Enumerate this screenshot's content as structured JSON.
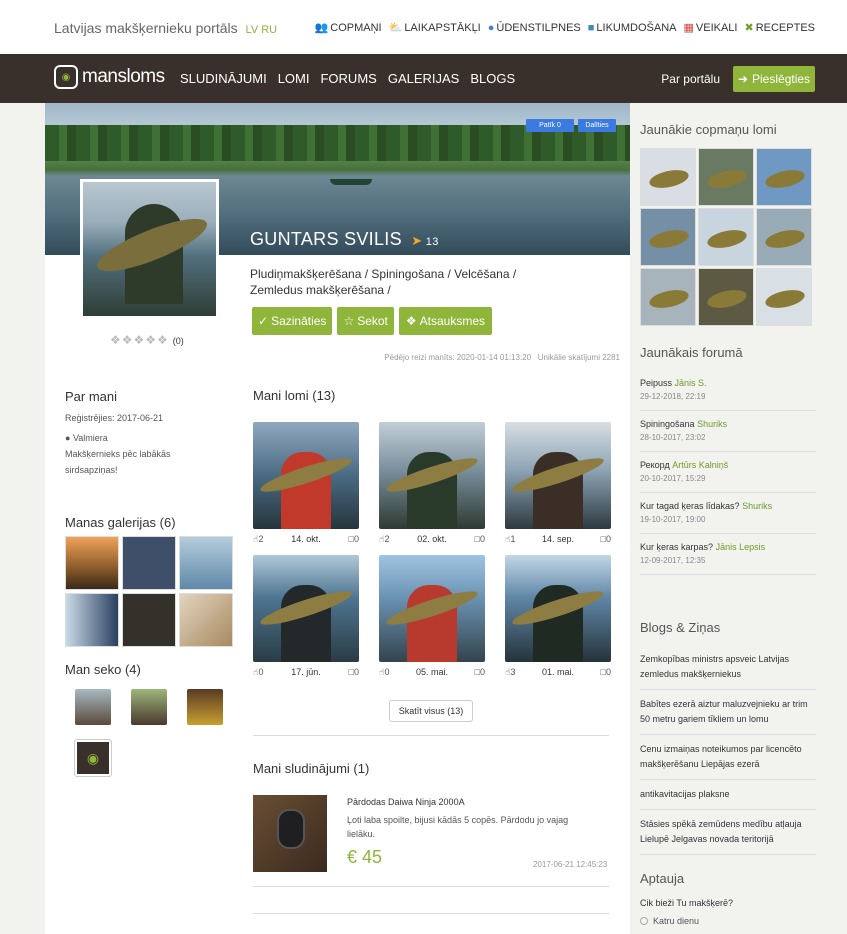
{
  "topbar": {
    "title": "Latvijas makšķernieku portāls",
    "lang": "LV RU",
    "links": [
      {
        "label": "COPMAŅI",
        "icon": "people-icon"
      },
      {
        "label": "LAIKAPSTĀKĻI",
        "icon": "weather-icon"
      },
      {
        "label": "ŪDENSTILPNES",
        "icon": "location-pin-icon"
      },
      {
        "label": "LIKUMDOŠANA",
        "icon": "book-icon"
      },
      {
        "label": "VEIKALI",
        "icon": "cart-icon"
      },
      {
        "label": "RECEPTES",
        "icon": "utensils-icon"
      }
    ]
  },
  "nav": {
    "logo_a": "mans",
    "logo_b": "loms",
    "items": [
      "SLUDINĀJUMI",
      "LOMI",
      "FORUMS",
      "GALERIJAS",
      "BLOGS"
    ],
    "about": "Par portālu",
    "login": "Pieslēgties"
  },
  "profile": {
    "fb_like": "Patīk 0",
    "fb_share": "Dalīties",
    "name": "GUNTARS SVILIS",
    "rank": "13",
    "rating_count": "(0)",
    "categories": "Pludiņmakšķerēšana / Spiningošana / Velcēšana / Zemledus makšķerēšana /",
    "buttons": [
      "Sazināties",
      "Sekot",
      "Atsauksmes"
    ],
    "last_seen": "Pēdējo reizi manīts: 2020-01-14 01:13:20",
    "unique_views": "Unikālie skatījumi 2281"
  },
  "about": {
    "title": "Par mani",
    "registered": "Reģistrējies: 2017-06-21",
    "location": "Valmiera",
    "bio": "Makšķernieks pēc labākās sirdsapziņas!"
  },
  "galleries": {
    "title": "Manas galerijas (6)"
  },
  "followers": {
    "title": "Man seko (4)"
  },
  "catches": {
    "title": "Mani lomi (13)",
    "items": [
      {
        "likes": "2",
        "date": "14. okt.",
        "comments": "0"
      },
      {
        "likes": "2",
        "date": "02. okt.",
        "comments": "0"
      },
      {
        "likes": "1",
        "date": "14. sep.",
        "comments": "0"
      },
      {
        "likes": "0",
        "date": "17. jūn.",
        "comments": "0"
      },
      {
        "likes": "0",
        "date": "05. mai.",
        "comments": "0"
      },
      {
        "likes": "3",
        "date": "01. mai.",
        "comments": "0"
      }
    ],
    "show_all": "Skatīt visus (13)"
  },
  "ads": {
    "title": "Mani sludinājumi (1)",
    "item_title": "Pārdodas Daiwa Ninja 2000A",
    "item_desc": "Ļoti laba spoilte, bijusi kādās 5 copēs. Pārdodu jo vajag lielāku.",
    "price": "€ 45",
    "date": "2017-06-21 12:45:23"
  },
  "sidebar": {
    "catches_title": "Jaunākie copmaņu lomi",
    "forum_title": "Jaunākais forumā",
    "forum": [
      {
        "topic": "Peipuss",
        "user": "Jānis S.",
        "date": "29-12-2018, 22:19"
      },
      {
        "topic": "Spiningošana",
        "user": "Shuriks",
        "date": "28-10-2017, 23:02"
      },
      {
        "topic": "Рекорд",
        "user": "Artūrs Kalniņš",
        "date": "20-10-2017, 15:29"
      },
      {
        "topic": "Kur tagad ķeras līdakas?",
        "user": "Shuriks",
        "date": "19-10-2017, 19:00"
      },
      {
        "topic": "Kur ķeras karpas?",
        "user": "Jānis Lepsis",
        "date": "12-09-2017, 12:35"
      }
    ],
    "blogs_title": "Blogs & Ziņas",
    "blogs": [
      "Zemkopības ministrs apsveic Latvijas zemledus makšķerniekus",
      "Babītes ezerā aiztur maluzvejnieku ar trim 50 metru gariem tīkliem un lomu",
      "Cenu izmaiņas noteikumos par licencēto makšķerēšanu Liepājas ezerā",
      "antikavitacijas plaksne",
      "Stāsies spēkā zemūdens medību atļauja Lielupē Jelgavas novada teritorijā"
    ],
    "poll_title": "Aptauja",
    "poll_question": "Cik bieži Tu makšķerē?",
    "poll_option": "Katru dienu"
  },
  "colors": {
    "accent": "#8fb63a",
    "nav_bg": "#3a302b"
  }
}
